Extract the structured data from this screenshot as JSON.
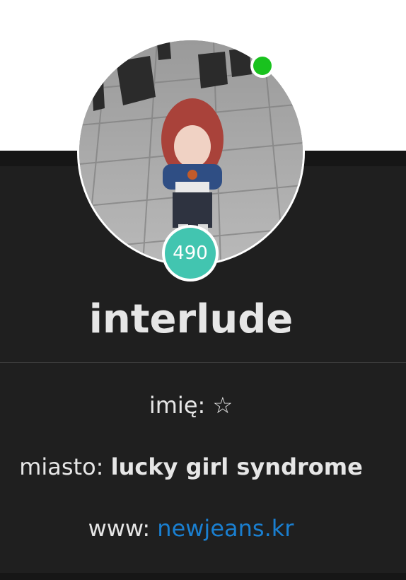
{
  "profile": {
    "username": "interlude",
    "score": "490",
    "status": "online",
    "avatar_alt": "profile photo"
  },
  "info": {
    "name_label": "imię: ",
    "name_value": "☆",
    "city_label": "miasto: ",
    "city_value": "lucky girl syndrome",
    "www_label": "www: ",
    "www_value": "newjeans.kr"
  },
  "colors": {
    "panel_bg": "#1f1f1f",
    "online": "#19c21e",
    "badge": "#42c5b0",
    "link": "#1a7fd0"
  }
}
